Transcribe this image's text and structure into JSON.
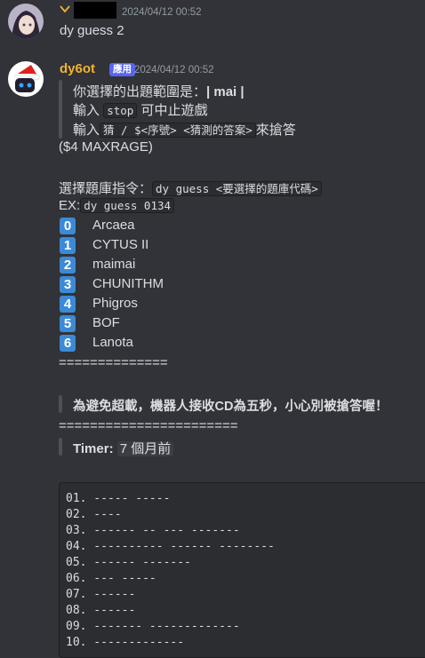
{
  "message1": {
    "timestamp": "2024/04/12 00:52",
    "content": "dy guess 2"
  },
  "message2": {
    "username": "dy6ot",
    "badge": "應用",
    "timestamp": "2024/04/12 00:52",
    "quote_range_prefix": "你選擇的出題範圍是：",
    "quote_range_value": "| mai |",
    "quote_stop_prefix": "輸入",
    "quote_stop_code": "stop",
    "quote_stop_suffix": "可中止遊戲",
    "quote_guess_prefix": "輸入",
    "quote_guess_code": "猜 / $<序號> <猜測的答案>",
    "quote_guess_suffix": "來搶答",
    "maxrage": "($4 MAXRAGE)",
    "select_label": "選擇題庫指令：",
    "select_code": "dy guess <要選擇的題庫代碼>",
    "ex_label": "EX:",
    "ex_code": "dy guess 0134",
    "databases": [
      {
        "num": "0",
        "name": "Arcaea"
      },
      {
        "num": "1",
        "name": "CYTUS II"
      },
      {
        "num": "2",
        "name": "maimai"
      },
      {
        "num": "3",
        "name": "CHUNITHM"
      },
      {
        "num": "4",
        "name": "Phigros"
      },
      {
        "num": "5",
        "name": "BOF"
      },
      {
        "num": "6",
        "name": "Lanota"
      }
    ],
    "divider1": "==============",
    "warning": "為避免超載，機器人接收CD為五秒，小心別被搶答喔！",
    "divider2": "=======================",
    "timer_label": "Timer:",
    "timer_value": "7 個月前",
    "blanks": [
      "01. ----- -----",
      "02. ----",
      "03. ------ -- --- -------",
      "04. ---------- ------ --------",
      "05. ------ -------",
      "06. --- -----",
      "07. ------",
      "08. ------",
      "09. ------- -------------",
      "10. -------------"
    ]
  },
  "colors": {
    "background": "#313338",
    "username": "#f0b232",
    "app_badge": "#5865f2",
    "number_badge": "#3c8ad6"
  }
}
